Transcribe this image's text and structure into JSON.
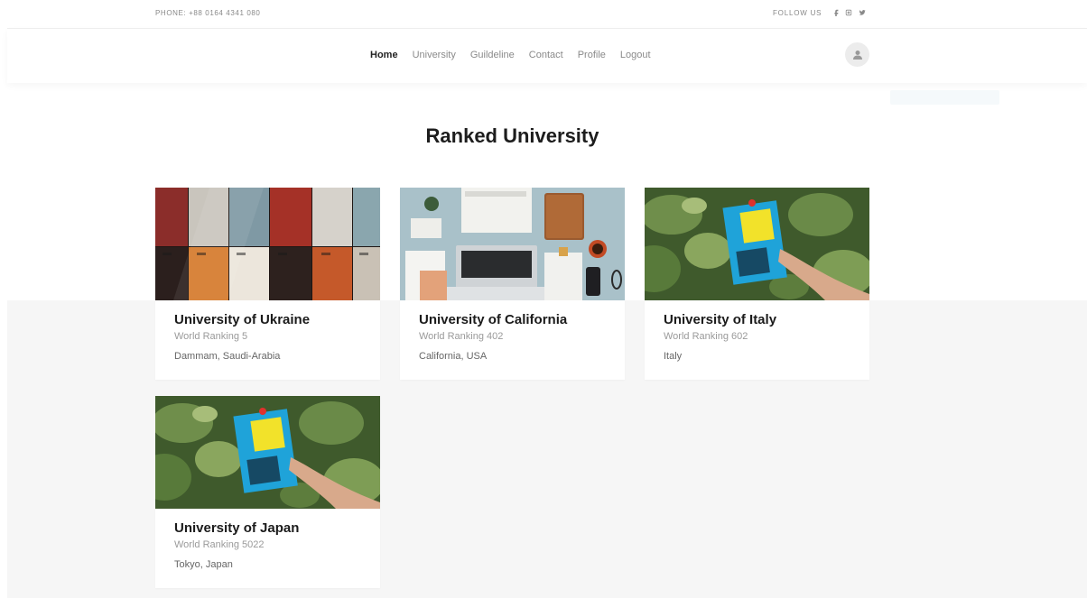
{
  "topbar": {
    "phone": "PHONE:  +88 0164 4341 080",
    "follow": "FOLLOW US",
    "social_icons": [
      "facebook-icon",
      "instagram-icon",
      "twitter-icon"
    ]
  },
  "nav": {
    "items": [
      {
        "label": "Home",
        "active": true
      },
      {
        "label": "University",
        "active": false
      },
      {
        "label": "Guildeline",
        "active": false
      },
      {
        "label": "Contact",
        "active": false
      },
      {
        "label": "Profile",
        "active": false
      },
      {
        "label": "Logout",
        "active": false
      }
    ],
    "avatar_icon": "user-icon"
  },
  "main": {
    "title": "Ranked University",
    "cards": [
      {
        "name": "University of Ukraine",
        "ranking": "World Ranking 5",
        "location": "Dammam, Saudi-Arabia",
        "image": "lockers-photo"
      },
      {
        "name": "University of California",
        "ranking": "World Ranking 402",
        "location": "California, USA",
        "image": "desk-laptop-photo"
      },
      {
        "name": "University of Italy",
        "ranking": "World Ranking 602",
        "location": "Italy",
        "image": "fluent-city-book-photo"
      },
      {
        "name": "University of Japan",
        "ranking": "World Ranking 5022",
        "location": "Tokyo, Japan",
        "image": "fluent-city-book-photo"
      }
    ]
  },
  "colors": {
    "accent_text": "#1d1d1d",
    "muted_text": "#8a8a8a",
    "band_background": "#f6f6f6"
  }
}
